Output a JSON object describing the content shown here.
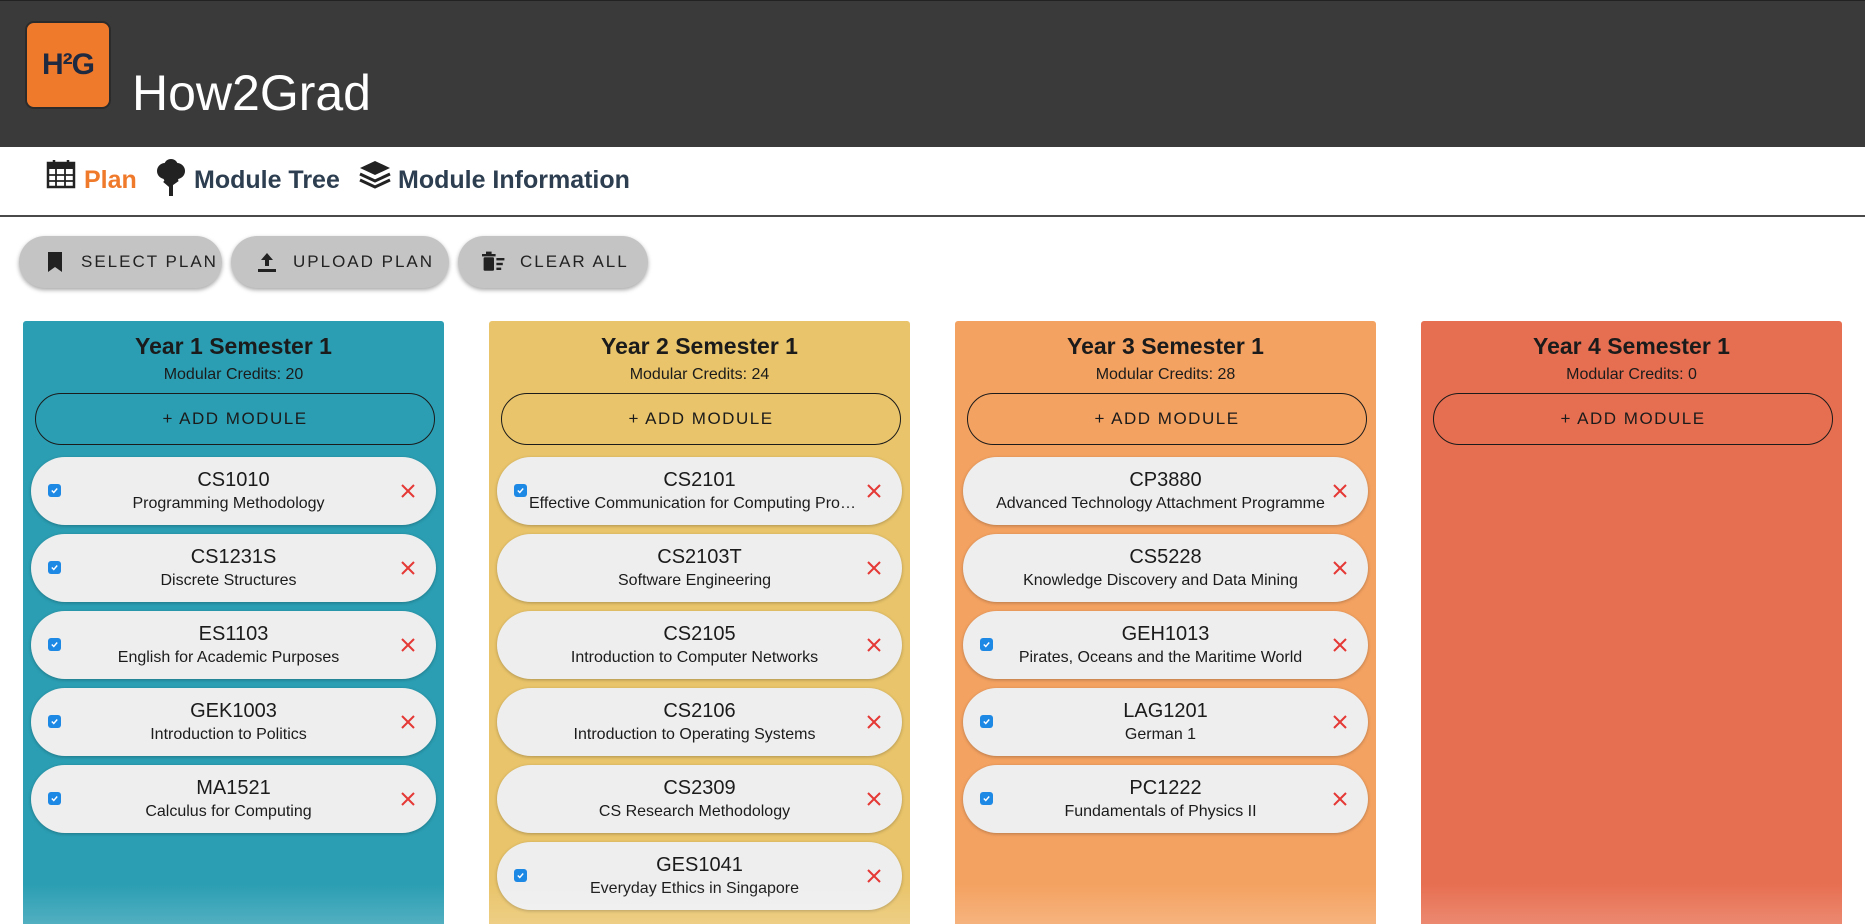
{
  "app": {
    "logo_text": "H²G",
    "title": "How2Grad"
  },
  "nav": {
    "items": [
      {
        "label": "Plan",
        "icon": "calendar-icon",
        "active": true
      },
      {
        "label": "Module Tree",
        "icon": "tree-icon",
        "active": false
      },
      {
        "label": "Module Information",
        "icon": "layers-icon",
        "active": false
      }
    ]
  },
  "toolbar": {
    "buttons": [
      {
        "label": "SELECT PLAN",
        "icon": "bookmark-icon"
      },
      {
        "label": "UPLOAD PLAN",
        "icon": "upload-icon"
      },
      {
        "label": "CLEAR ALL",
        "icon": "delete-sweep-icon"
      }
    ]
  },
  "colors": {
    "header_bg": "#3a3a3a",
    "logo_bg": "#f07a2c",
    "nav_active": "#f07a2c",
    "nav_inactive": "#2c3e50",
    "check": "#1e88e5",
    "remove": "#e53935"
  },
  "semesters": [
    {
      "title": "Year 1 Semester 1",
      "credits_label": "Modular Credits: 20",
      "add_label": "+ ADD MODULE",
      "color": "#2b9eb3",
      "modules": [
        {
          "code": "CS1010",
          "name": "Programming Methodology",
          "checked": true
        },
        {
          "code": "CS1231S",
          "name": "Discrete Structures",
          "checked": true
        },
        {
          "code": "ES1103",
          "name": "English for Academic Purposes",
          "checked": true
        },
        {
          "code": "GEK1003",
          "name": "Introduction to Politics",
          "checked": true
        },
        {
          "code": "MA1521",
          "name": "Calculus for Computing",
          "checked": true
        }
      ]
    },
    {
      "title": "Year 2 Semester 1",
      "credits_label": "Modular Credits: 24",
      "add_label": "+ ADD MODULE",
      "color": "#e9c46a",
      "modules": [
        {
          "code": "CS2101",
          "name": "Effective Communication for Computing Professionals",
          "checked": true
        },
        {
          "code": "CS2103T",
          "name": "Software Engineering",
          "checked": false
        },
        {
          "code": "CS2105",
          "name": "Introduction to Computer Networks",
          "checked": false
        },
        {
          "code": "CS2106",
          "name": "Introduction to Operating Systems",
          "checked": false
        },
        {
          "code": "CS2309",
          "name": "CS Research Methodology",
          "checked": false
        },
        {
          "code": "GES1041",
          "name": "Everyday Ethics in Singapore",
          "checked": true
        }
      ]
    },
    {
      "title": "Year 3 Semester 1",
      "credits_label": "Modular Credits: 28",
      "add_label": "+ ADD MODULE",
      "color": "#f4a261",
      "modules": [
        {
          "code": "CP3880",
          "name": "Advanced Technology Attachment Programme",
          "checked": false
        },
        {
          "code": "CS5228",
          "name": "Knowledge Discovery and Data Mining",
          "checked": false
        },
        {
          "code": "GEH1013",
          "name": "Pirates, Oceans and the Maritime World",
          "checked": true
        },
        {
          "code": "LAG1201",
          "name": "German 1",
          "checked": true
        },
        {
          "code": "PC1222",
          "name": "Fundamentals of Physics II",
          "checked": true
        }
      ]
    },
    {
      "title": "Year 4 Semester 1",
      "credits_label": "Modular Credits: 0",
      "add_label": "+ ADD MODULE",
      "color": "#e76f51",
      "modules": []
    }
  ]
}
